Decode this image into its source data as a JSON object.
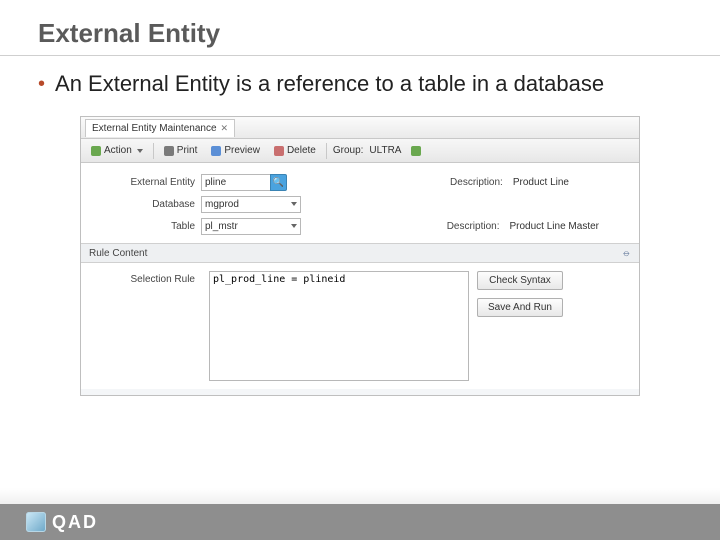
{
  "title": "External Entity",
  "bullet": "An External Entity is a reference to a table in a database",
  "brand": "QAD",
  "tab": {
    "label": "External Entity Maintenance"
  },
  "toolbar": {
    "action": "Action",
    "print": "Print",
    "preview": "Preview",
    "delete": "Delete",
    "group_label": "Group:",
    "group_value": "ULTRA"
  },
  "form": {
    "external_entity_label": "External Entity",
    "external_entity_value": "pline",
    "desc_label": "Description:",
    "desc_value": "Product Line",
    "database_label": "Database",
    "database_value": "mgprod",
    "table_label": "Table",
    "table_value": "pl_mstr",
    "table_desc_label": "Description:",
    "table_desc_value": "Product Line Master"
  },
  "section": {
    "rule_header": "Rule Content"
  },
  "rule": {
    "selection_label": "Selection Rule",
    "selection_value": "pl_prod_line = plineid",
    "check_btn": "Check Syntax",
    "save_btn": "Save And Run"
  }
}
